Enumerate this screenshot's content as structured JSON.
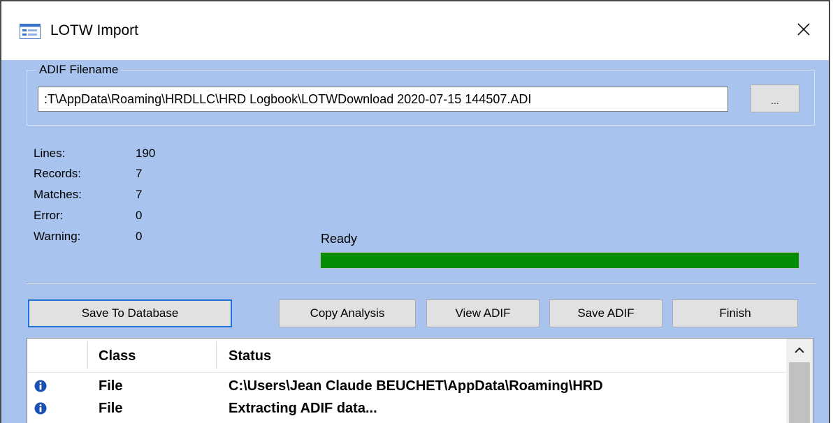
{
  "window": {
    "title": "LOTW Import",
    "icon": "form-window-icon",
    "close_icon": "close-icon"
  },
  "file": {
    "group_label": "ADIF Filename",
    "value": ":T\\AppData\\Roaming\\HRDLLC\\HRD Logbook\\LOTWDownload 2020-07-15 144507.ADI",
    "browse_label": "..."
  },
  "stats": [
    {
      "label": "Lines:",
      "value": "190"
    },
    {
      "label": "Records:",
      "value": "7"
    },
    {
      "label": "Matches:",
      "value": "7"
    },
    {
      "label": "Error:",
      "value": "0"
    },
    {
      "label": "Warning:",
      "value": "0"
    }
  ],
  "progress": {
    "status": "Ready",
    "fraction": 1.0,
    "color": "#068d06"
  },
  "buttons": {
    "save_db": "Save To Database",
    "copy_analysis": "Copy Analysis",
    "view_adif": "View ADIF",
    "save_adif": "Save ADIF",
    "finish": "Finish"
  },
  "grid": {
    "columns": [
      "",
      "Class",
      "Status"
    ],
    "rows": [
      {
        "icon": "info-icon",
        "class": "File",
        "status": "C:\\Users\\Jean Claude BEUCHET\\AppData\\Roaming\\HRD"
      },
      {
        "icon": "info-icon",
        "class": "File",
        "status": "Extracting ADIF data..."
      }
    ]
  },
  "colors": {
    "dialog_bg": "#a8c4ee",
    "accent_border": "#1f6fd6",
    "info_blue": "#1a4fb3"
  }
}
